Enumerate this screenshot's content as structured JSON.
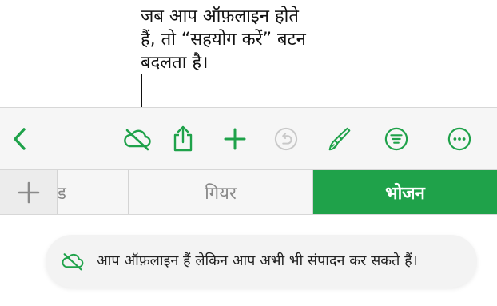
{
  "callout": {
    "lines": [
      "जब आप ऑफ़लाइन होते",
      "हैं, तो “सहयोग करें” बटन",
      "बदलता है।"
    ]
  },
  "colors": {
    "accent": "#1fa24a",
    "icon_gray": "#c9c9c9"
  },
  "toolbar": {
    "buttons": [
      {
        "icon": "back-chevron-icon"
      },
      {
        "icon": "offline-cloud-icon"
      },
      {
        "icon": "share-icon"
      },
      {
        "icon": "add-icon"
      },
      {
        "icon": "undo-icon"
      },
      {
        "icon": "format-brush-icon"
      },
      {
        "icon": "organize-filter-icon"
      },
      {
        "icon": "more-icon"
      }
    ]
  },
  "tabs": {
    "add_icon": "plus-icon",
    "items": [
      {
        "label": "ट्रेंड"
      },
      {
        "label": "गियर"
      },
      {
        "label": "भोजन",
        "selected": true
      }
    ]
  },
  "toast": {
    "icon": "offline-cloud-icon",
    "message": "आप ऑफ़लाइन हैं लेकिन आप अभी भी संपादन कर सकते हैं।"
  }
}
